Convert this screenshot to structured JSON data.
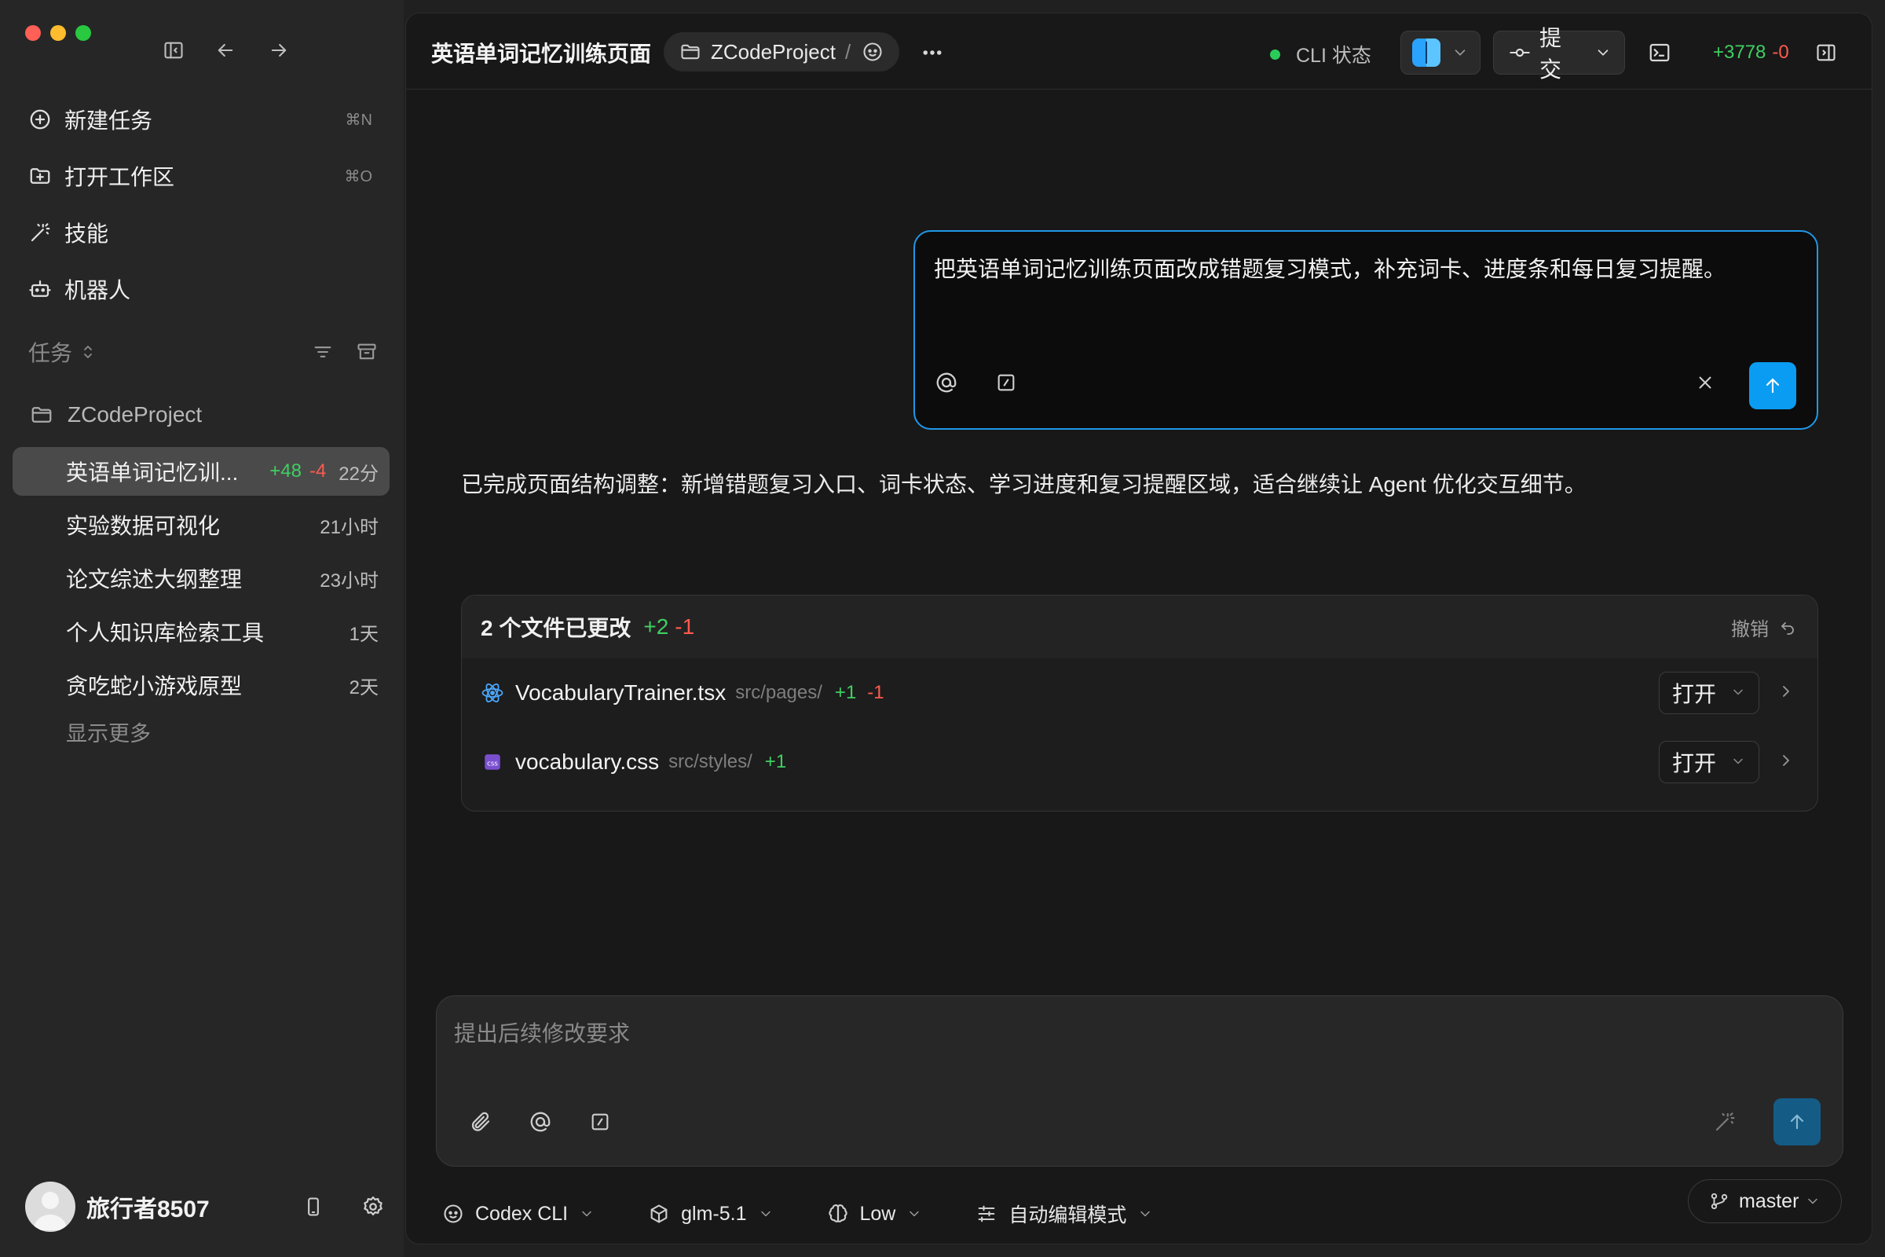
{
  "sidebar": {
    "nav": [
      {
        "label": "新建任务",
        "shortcut": "⌘N",
        "icon": "plus-circle-icon"
      },
      {
        "label": "打开工作区",
        "shortcut": "⌘O",
        "icon": "folder-plus-icon"
      },
      {
        "label": "技能",
        "icon": "magic-wand-icon"
      },
      {
        "label": "机器人",
        "icon": "robot-icon"
      }
    ],
    "section_label": "任务",
    "project_name": "ZCodeProject",
    "tasks": [
      {
        "title": "英语单词记忆训...",
        "adds": "+48",
        "dels": "-4",
        "time": "22分",
        "active": true
      },
      {
        "title": "实验数据可视化",
        "time": "21小时"
      },
      {
        "title": "论文综述大纲整理",
        "time": "23小时"
      },
      {
        "title": "个人知识库检索工具",
        "time": "1天"
      },
      {
        "title": "贪吃蛇小游戏原型",
        "time": "2天"
      }
    ],
    "show_more": "显示更多",
    "user_name": "旅行者8507"
  },
  "topbar": {
    "title": "英语单词记忆训练页面",
    "project": "ZCodeProject",
    "separator": "/",
    "cli_status": "CLI 状态",
    "commit_label": "提交",
    "diff_adds": "+3778",
    "diff_dels": "-0"
  },
  "chat": {
    "user_prompt": "把英语单词记忆训练页面改成错题复习模式，补充词卡、进度条和每日复习提醒。",
    "assistant_reply": "已完成页面结构调整：新增错题复习入口、词卡状态、学习进度和复习提醒区域，适合继续让 Agent 优化交互细节。"
  },
  "changes": {
    "title": "2 个文件已更改",
    "adds": "+2",
    "dels": "-1",
    "undo_label": "撤销",
    "files": [
      {
        "name": "VocabularyTrainer.tsx",
        "path": "src/pages/",
        "adds": "+1",
        "dels": "-1",
        "icon": "react-icon",
        "open_label": "打开"
      },
      {
        "name": "vocabulary.css",
        "path": "src/styles/",
        "adds": "+1",
        "icon": "css-file-icon",
        "open_label": "打开"
      }
    ]
  },
  "composer": {
    "placeholder": "提出后续修改要求"
  },
  "bottom": {
    "agent": "Codex CLI",
    "model": "glm-5.1",
    "effort": "Low",
    "mode": "自动编辑模式",
    "branch": "master"
  },
  "colors": {
    "accent": "#0a9cf2",
    "added": "#3fcf62",
    "removed": "#ff5a4f",
    "status_ok": "#2bcb5a"
  }
}
